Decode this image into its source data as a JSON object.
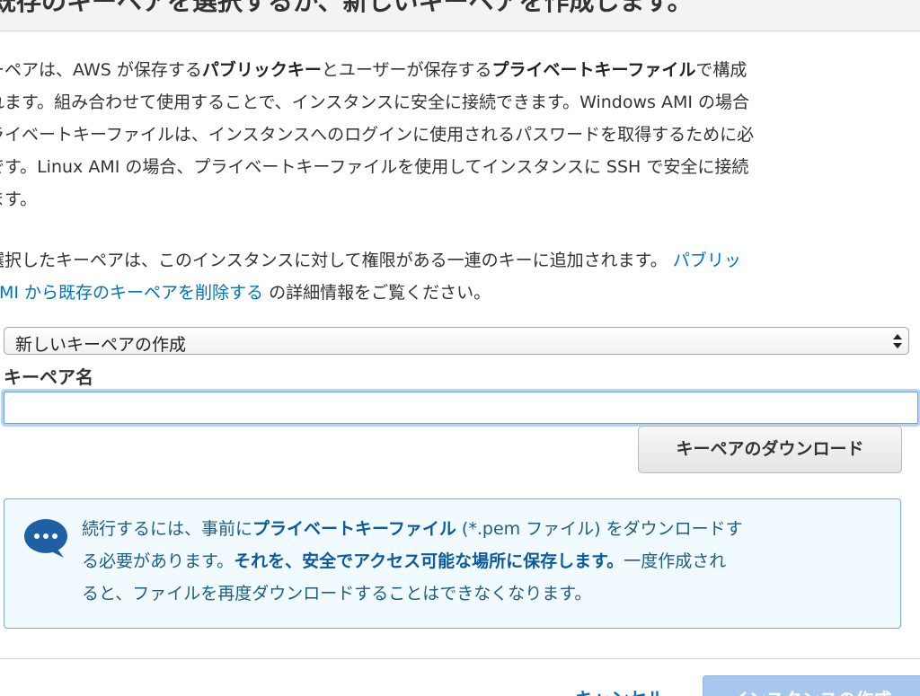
{
  "modal": {
    "title": "既存のキーペアを選択するか、新しいキーペアを作成します。"
  },
  "description": {
    "p1": [
      {
        "t": "キーペアは、AWS が保存する",
        "b": false
      },
      {
        "t": "パブリックキー",
        "b": true
      },
      {
        "t": "とユーザーが保存する",
        "b": false
      },
      {
        "t": "プライベートキーファイル",
        "b": true
      },
      {
        "t": "で構成されます。組み合わせて使用することで、インスタンスに安全に接続できます。Windows AMI の場合、",
        "b": false
      },
      {
        "t": "プライベートキーファイルは、インスタンスへのログインに使用されるパスワードを取得するために必要です。Linux AMI の場合、プライベートキーファイルを使用してインスタンスに SSH で安全に接続できます。",
        "b": false
      }
    ],
    "p1_lines": [
      "ーペアは、AWS が保存する",
      "れます。組み合わせて使用することで、インスタンスに安全に接続できます。Windows AMI の場合",
      "ライベートキーファイルは、インスタンスへのログインに使用されるパスワードを取得するために必",
      "です。Linux AMI の場合、プライベートキーファイルを使用してインスタンスに SSH で安全に接続",
      "ます。"
    ],
    "p1_bold_1": "パブリックキー",
    "p1_mid": "とユーザーが保存する",
    "p1_bold_2": "プライベートキーファイル",
    "p1_end": "で構成",
    "p2_line1": "選択したキーペアは、このインスタンスに対して権限がある一連のキーに追加されます。",
    "p2_link1": "パブリッ",
    "p2_link2": "AMI から既存のキーペアを削除する",
    "p2_tail": " の詳細情報をご覧ください。"
  },
  "keypair_select": {
    "selected": "新しいキーペアの作成"
  },
  "keypair_name": {
    "label": "キーペア名",
    "value": ""
  },
  "download_button": {
    "label": "キーペアのダウンロード"
  },
  "info_box": {
    "t1": "続行するには、事前に",
    "b1": "プライベートキーファイル",
    "t2": " (*.pem ファイル) をダウンロードす",
    "t3": "る必要があります。",
    "b2": "それを、安全でアクセス可能な場所に保存します。",
    "t4": "一度作成され",
    "t5": "ると、ファイルを再度ダウンロードすることはできなくなります。"
  },
  "footer": {
    "cancel_label": "キャンセル",
    "launch_label": "インスタンスの作成"
  },
  "colors": {
    "link": "#0073bb",
    "info_border": "#77a7d4",
    "info_bg": "#f1faff",
    "primary_disabled": "#a6c8ec"
  }
}
